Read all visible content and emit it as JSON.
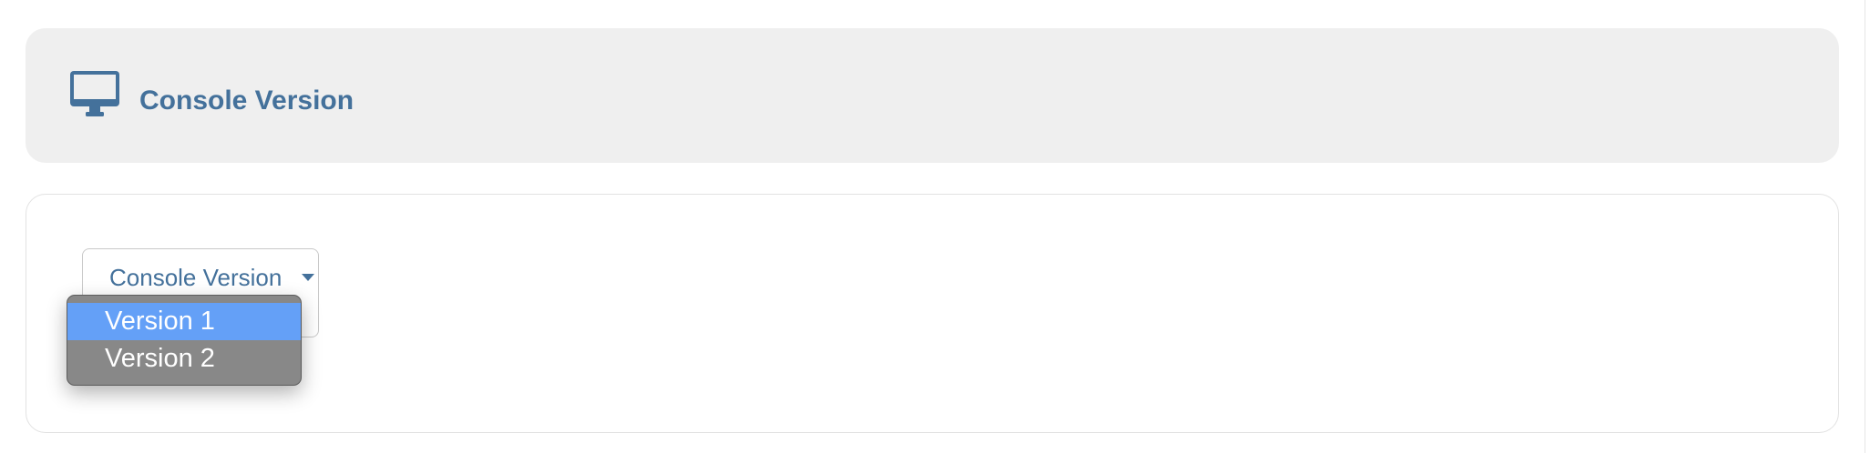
{
  "header": {
    "icon": "desktop-monitor-icon",
    "title": "Console Version"
  },
  "select": {
    "label": "Console Version",
    "caret_icon": "caret-down-icon",
    "is_open": true
  },
  "dropdown": {
    "options": [
      {
        "label": "Version 1",
        "highlighted": true
      },
      {
        "label": "Version 2",
        "highlighted": false
      }
    ]
  },
  "colors": {
    "accent": "#44719b",
    "header_bg": "#efefef",
    "option_highlight": "#64a0f7",
    "dropdown_bg": "#888888"
  }
}
